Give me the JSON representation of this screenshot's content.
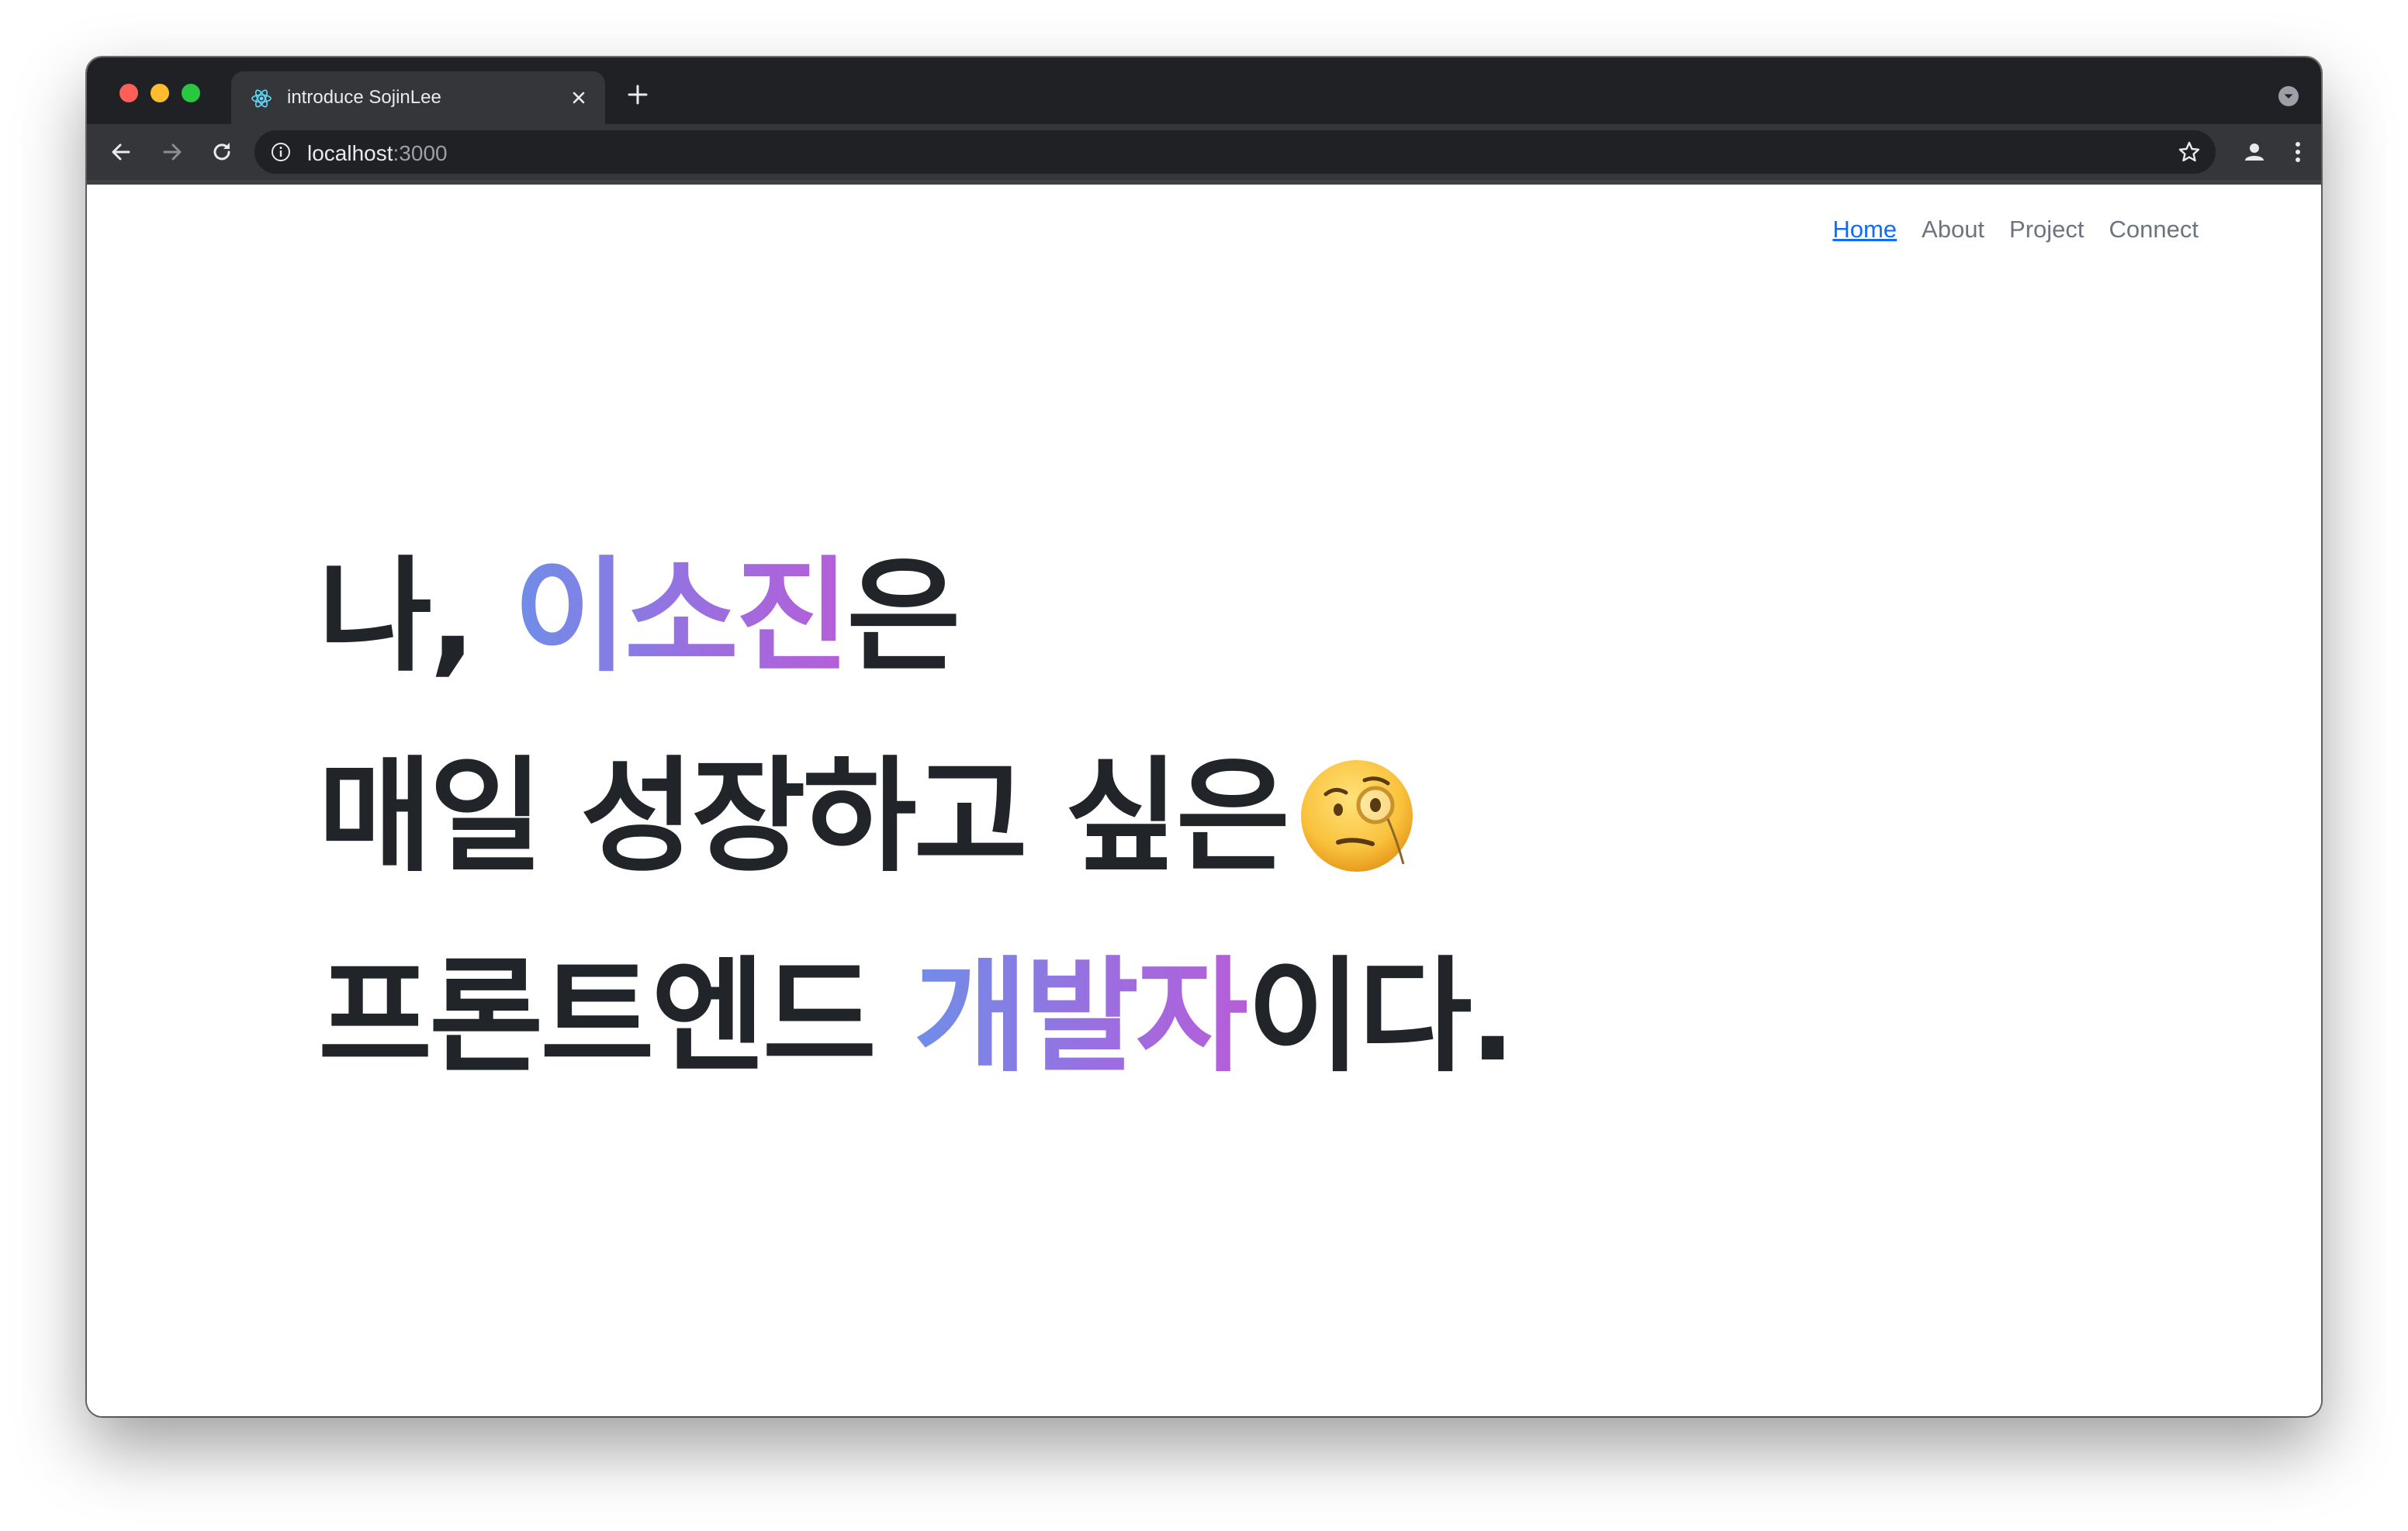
{
  "browser": {
    "tab": {
      "title": "introduce SojinLee",
      "favicon": "react-icon"
    },
    "address": {
      "host": "localhost",
      "port": ":3000"
    },
    "colors": {
      "chrome_dark": "#202124",
      "chrome_mid": "#35363a"
    }
  },
  "nav": {
    "items": [
      {
        "label": "Home",
        "active": true
      },
      {
        "label": "About",
        "active": false
      },
      {
        "label": "Project",
        "active": false
      },
      {
        "label": "Connect",
        "active": false
      }
    ],
    "active_color": "#0d6efd",
    "color": "#6c757d"
  },
  "hero": {
    "line1": {
      "prefix": "나, ",
      "highlight": "이소진",
      "suffix": "은"
    },
    "line2": {
      "text": "매일 성장하고 싶은",
      "emoji": "face-with-monocle-icon"
    },
    "line3": {
      "prefix": "프론트엔드 ",
      "highlight": "개발자",
      "suffix": "이다."
    },
    "text_color": "#212529",
    "gradient": [
      "#6f8ee8",
      "#9a6fe0",
      "#b65ed8"
    ]
  }
}
